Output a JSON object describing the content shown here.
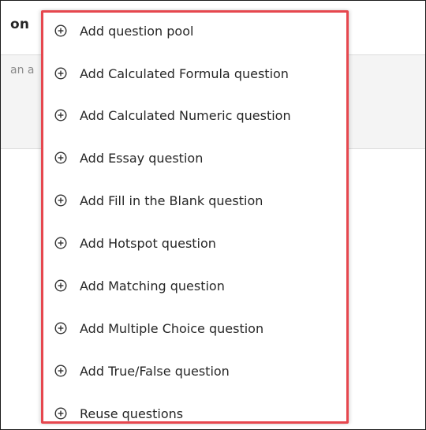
{
  "background": {
    "title_fragment": "on",
    "description_fragment": "an a"
  },
  "menu": {
    "accent_color": "#e6474e",
    "items": [
      {
        "label": "Add question pool",
        "icon": "add-circle-icon"
      },
      {
        "label": "Add Calculated Formula question",
        "icon": "add-circle-icon"
      },
      {
        "label": "Add Calculated Numeric question",
        "icon": "add-circle-icon"
      },
      {
        "label": "Add Essay question",
        "icon": "add-circle-icon"
      },
      {
        "label": "Add Fill in the Blank question",
        "icon": "add-circle-icon"
      },
      {
        "label": "Add Hotspot question",
        "icon": "add-circle-icon"
      },
      {
        "label": "Add Matching question",
        "icon": "add-circle-icon"
      },
      {
        "label": "Add Multiple Choice question",
        "icon": "add-circle-icon"
      },
      {
        "label": "Add True/False question",
        "icon": "add-circle-icon"
      },
      {
        "label": "Reuse questions",
        "icon": "add-circle-icon"
      }
    ]
  }
}
